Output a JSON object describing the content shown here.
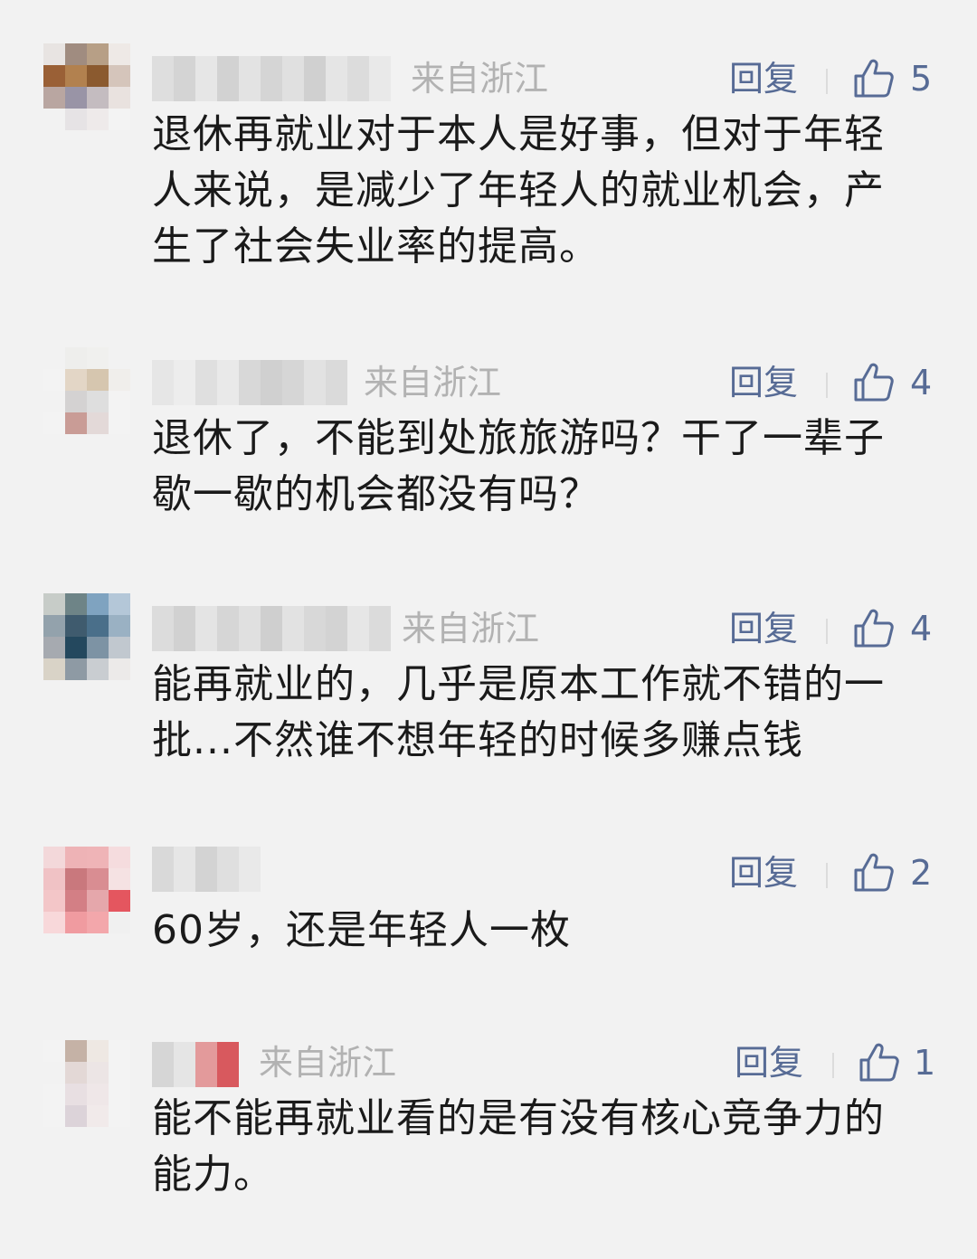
{
  "comments": [
    {
      "location": "来自浙江",
      "reply_label": "回复",
      "likes": "5",
      "text": "退休再就业对于本人是好事，但对于年轻人来说，是减少了年轻人的就业机会，产生了社会失业率的提高。"
    },
    {
      "location": "来自浙江",
      "reply_label": "回复",
      "likes": "4",
      "text": "退休了，不能到处旅旅游吗？干了一辈子歇一歇的机会都没有吗？"
    },
    {
      "location": "来自浙江",
      "reply_label": "回复",
      "likes": "4",
      "text": "能再就业的，几乎是原本工作就不错的一批...不然谁不想年轻的时候多赚点钱"
    },
    {
      "location": "",
      "reply_label": "回复",
      "likes": "2",
      "text": "60岁，还是年轻人一枚"
    },
    {
      "location": "来自浙江",
      "reply_label": "回复",
      "likes": "1",
      "text": "能不能再就业看的是有没有核心竞争力的能力。"
    }
  ],
  "colors": {
    "background": "#f2f2f2",
    "link": "#576b95",
    "meta": "#b2b2b2",
    "text": "#1a1a1a"
  },
  "icons": {
    "like": "thumbs-up-icon"
  }
}
